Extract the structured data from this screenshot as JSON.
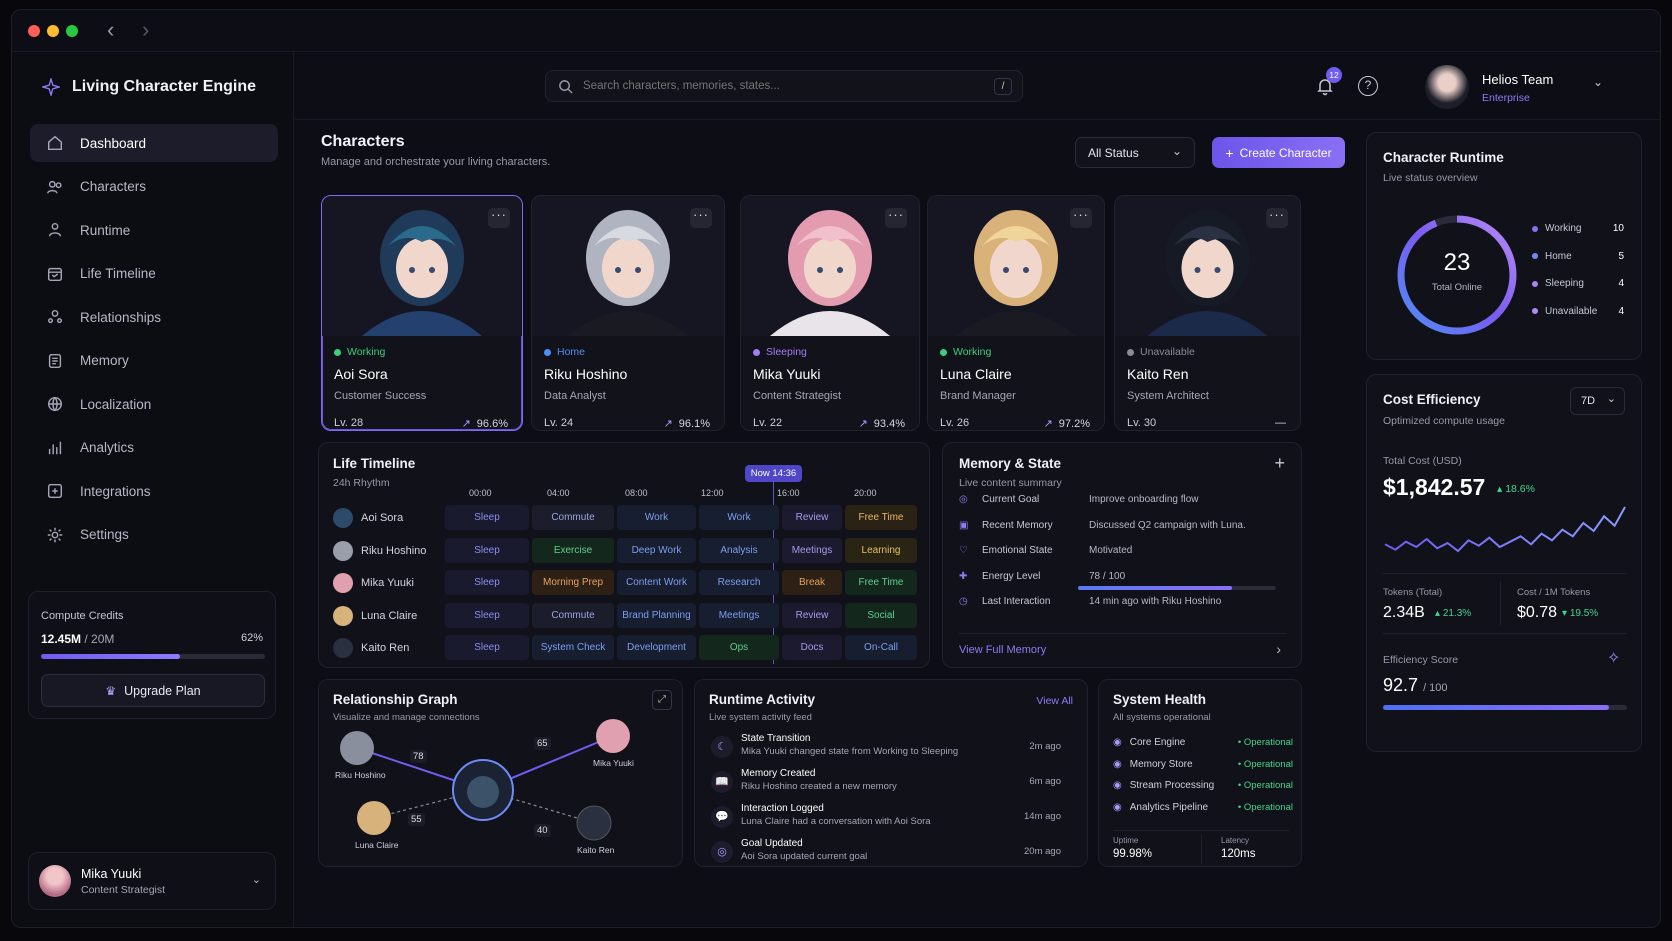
{
  "app": {
    "title": "Living Character Engine"
  },
  "nav": [
    {
      "label": "Dashboard",
      "icon": "home-icon"
    },
    {
      "label": "Characters",
      "icon": "users-icon"
    },
    {
      "label": "Runtime",
      "icon": "runtime-icon"
    },
    {
      "label": "Life Timeline",
      "icon": "calendar-icon"
    },
    {
      "label": "Relationships",
      "icon": "relationships-icon"
    },
    {
      "label": "Memory",
      "icon": "memory-icon"
    },
    {
      "label": "Localization",
      "icon": "globe-icon"
    },
    {
      "label": "Analytics",
      "icon": "bar-chart-icon"
    },
    {
      "label": "Integrations",
      "icon": "integrations-icon"
    },
    {
      "label": "Settings",
      "icon": "gear-icon"
    }
  ],
  "credits": {
    "label": "Compute Credits",
    "used": "12.45M",
    "total": "/ 20M",
    "percent": "62%",
    "fraction": 0.62,
    "upgrade": "Upgrade Plan"
  },
  "current_user": {
    "name": "Mika Yuuki",
    "role": "Content Strategist"
  },
  "search": {
    "placeholder": "Search characters, memories, states...",
    "shortcut": "/"
  },
  "header": {
    "notifications": "12",
    "team": "Helios Team",
    "plan": "Enterprise"
  },
  "characters": {
    "title": "Characters",
    "subtitle": "Manage and orchestrate your living characters.",
    "filter": "All Status",
    "create": "Create Character",
    "more": "···",
    "list": [
      {
        "status": "Working",
        "status_color": "#3ecf7a",
        "name": "Aoi Sora",
        "role": "Customer Success",
        "level": "Lv.  28",
        "score": "96.6%"
      },
      {
        "status": "Home",
        "status_color": "#4d8ff5",
        "name": "Riku Hoshino",
        "role": "Data Analyst",
        "level": "Lv.  24",
        "score": "96.1%"
      },
      {
        "status": "Sleeping",
        "status_color": "#a57cf5",
        "name": "Mika Yuuki",
        "role": "Content Strategist",
        "level": "Lv.  22",
        "score": "93.4%"
      },
      {
        "status": "Working",
        "status_color": "#3ecf7a",
        "name": "Luna Claire",
        "role": "Brand Manager",
        "level": "Lv.  26",
        "score": "97.2%"
      },
      {
        "status": "Unavailable",
        "status_color": "#8a8a99",
        "name": "Kaito Ren",
        "role": "System Architect",
        "level": "Lv.  30",
        "score": "—"
      }
    ]
  },
  "runtime": {
    "title": "Character Runtime",
    "subtitle": "Live status overview",
    "total": "23",
    "total_label": "Total Online",
    "legend": [
      {
        "label": "Working",
        "value": "10",
        "color": "#8b6ff0"
      },
      {
        "label": "Home",
        "value": "5",
        "color": "#6f8cf5"
      },
      {
        "label": "Sleeping",
        "value": "4",
        "color": "#a985f0"
      },
      {
        "label": "Unavailable",
        "value": "4",
        "color": "#b08af0"
      }
    ]
  },
  "cost": {
    "title": "Cost Efficiency",
    "subtitle": "Optimized compute usage",
    "range": "7D",
    "total_label": "Total Cost (USD)",
    "total": "$1,842.57",
    "total_change": "18.6%",
    "tokens_label": "Tokens (Total)",
    "tokens": "2.34B",
    "tokens_change": "21.3%",
    "per_label": "Cost / 1M Tokens",
    "per": "$0.78",
    "per_change": "19.5%",
    "eff_label": "Efficiency Score",
    "eff": "92.7",
    "eff_max": "/ 100",
    "eff_fraction": 0.927,
    "trend": [
      24,
      20,
      26,
      22,
      28,
      21,
      25,
      19,
      27,
      23,
      29,
      22,
      26,
      30,
      24,
      32,
      27,
      35,
      30,
      40,
      34,
      45,
      38,
      52
    ]
  },
  "timeline": {
    "title": "Life Timeline",
    "subtitle": "24h Rhythm",
    "now": "Now 14:36",
    "hours": [
      "00:00",
      "04:00",
      "08:00",
      "12:00",
      "16:00",
      "20:00"
    ],
    "rows": [
      {
        "name": "Aoi Sora",
        "blocks": [
          "Sleep",
          "Commute",
          "Work",
          "Work",
          "Review",
          "Free Time"
        ],
        "kinds": [
          "sleep",
          "commute",
          "work",
          "work",
          "review",
          "free"
        ]
      },
      {
        "name": "Riku Hoshino",
        "blocks": [
          "Sleep",
          "Exercise",
          "Deep Work",
          "Analysis",
          "Meetings",
          "Learning"
        ],
        "kinds": [
          "sleep",
          "green",
          "work",
          "work",
          "review",
          "gold"
        ]
      },
      {
        "name": "Mika Yuuki",
        "blocks": [
          "Sleep",
          "Morning Prep",
          "Content Work",
          "Research",
          "Break",
          "Free Time"
        ],
        "kinds": [
          "sleep",
          "orange",
          "work",
          "work",
          "orange",
          "green"
        ]
      },
      {
        "name": "Luna Claire",
        "blocks": [
          "Sleep",
          "Commute",
          "Brand Planning",
          "Meetings",
          "Review",
          "Social"
        ],
        "kinds": [
          "sleep",
          "commute",
          "work",
          "work",
          "review",
          "green"
        ]
      },
      {
        "name": "Kaito Ren",
        "blocks": [
          "Sleep",
          "System Check",
          "Development",
          "Ops",
          "Docs",
          "On-Call"
        ],
        "kinds": [
          "sleep",
          "work",
          "work",
          "green",
          "review",
          "work"
        ]
      }
    ]
  },
  "memory": {
    "title": "Memory & State",
    "subtitle": "Live content summary",
    "rows": [
      {
        "label": "Current Goal",
        "value": "Improve onboarding flow",
        "icon": "target-icon"
      },
      {
        "label": "Recent Memory",
        "value": "Discussed Q2 campaign with Luna.",
        "icon": "memory-icon"
      },
      {
        "label": "Emotional State",
        "value": "Motivated",
        "icon": "heart-icon"
      },
      {
        "label": "Energy Level",
        "value": "78 / 100",
        "icon": "energy-icon",
        "fraction": 0.78
      },
      {
        "label": "Last Interaction",
        "value": "14 min ago with Riku Hoshino",
        "icon": "clock-icon"
      }
    ],
    "link": "View Full Memory"
  },
  "relationships": {
    "title": "Relationship Graph",
    "subtitle": "Visualize and manage connections",
    "nodes": [
      {
        "name": "Riku Hoshino",
        "weight": "78"
      },
      {
        "name": "Mika Yuuki",
        "weight": "65"
      },
      {
        "name": "Luna Claire",
        "weight": "55"
      },
      {
        "name": "Kaito Ren",
        "weight": "40"
      }
    ]
  },
  "activity": {
    "title": "Runtime Activity",
    "subtitle": "Live system activity feed",
    "view_all": "View All",
    "items": [
      {
        "title": "State Transition",
        "desc": "Mika Yuuki changed state from Working to Sleeping",
        "time": "2m ago",
        "icon": "moon-icon"
      },
      {
        "title": "Memory Created",
        "desc": "Riku Hoshino created a new memory",
        "time": "6m ago",
        "icon": "book-icon"
      },
      {
        "title": "Interaction Logged",
        "desc": "Luna Claire had a conversation with Aoi Sora",
        "time": "14m ago",
        "icon": "chat-icon"
      },
      {
        "title": "Goal Updated",
        "desc": "Aoi Sora updated current goal",
        "time": "20m ago",
        "icon": "target-icon"
      }
    ]
  },
  "health": {
    "title": "System Health",
    "subtitle": "All systems operational",
    "items": [
      {
        "name": "Core Engine",
        "status": "• Operational"
      },
      {
        "name": "Memory Store",
        "status": "• Operational"
      },
      {
        "name": "Stream Processing",
        "status": "• Operational"
      },
      {
        "name": "Analytics Pipeline",
        "status": "• Operational"
      }
    ],
    "uptime_label": "Uptime",
    "uptime": "99.98%",
    "latency_label": "Latency",
    "latency": "120ms"
  },
  "colors": {
    "accent": "#7c5cf0",
    "bg": "#0d0d15",
    "green": "#46d68c"
  }
}
